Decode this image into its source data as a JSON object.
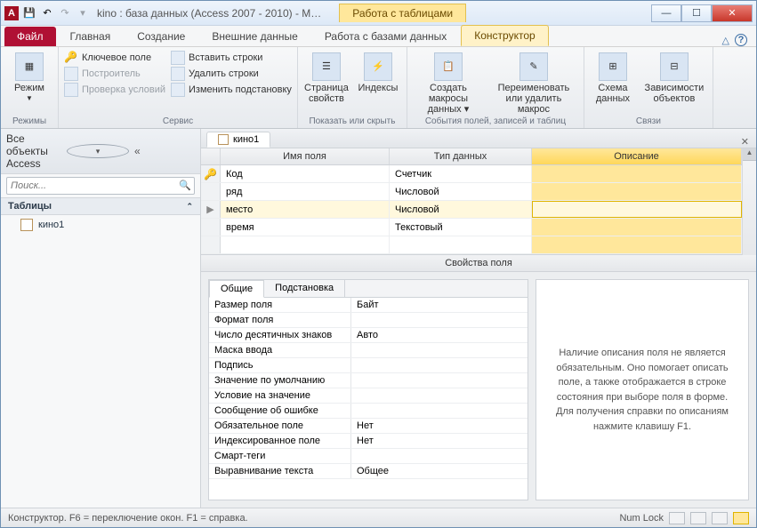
{
  "titlebar": {
    "title": "kino : база данных (Access 2007 - 2010) -  M…",
    "context_tab": "Работа с таблицами"
  },
  "tabs": {
    "file": "Файл",
    "items": [
      "Главная",
      "Создание",
      "Внешние данные",
      "Работа с базами данных"
    ],
    "context": "Конструктор"
  },
  "ribbon": {
    "group_modes": {
      "mode_btn": "Режим",
      "label": "Режимы"
    },
    "group_service": {
      "key_field": "Ключевое поле",
      "builder": "Построитель",
      "check_cond": "Проверка условий",
      "insert_rows": "Вставить строки",
      "delete_rows": "Удалить строки",
      "change_lookup": "Изменить подстановку",
      "label": "Сервис"
    },
    "group_show": {
      "prop_page": "Страница свойств",
      "indexes": "Индексы",
      "label": "Показать или скрыть"
    },
    "group_events": {
      "create_macros": "Создать макросы данных ▾",
      "rename_delete": "Переименовать или удалить макрос",
      "label": "События полей, записей и таблиц"
    },
    "group_rel": {
      "schema": "Схема данных",
      "deps": "Зависимости объектов",
      "label": "Связи"
    }
  },
  "nav": {
    "header": "Все объекты Access",
    "search_placeholder": "Поиск...",
    "section": "Таблицы",
    "items": [
      "кино1"
    ]
  },
  "doc": {
    "tab": "кино1",
    "headers": {
      "name": "Имя поля",
      "type": "Тип данных",
      "desc": "Описание"
    },
    "rows": [
      {
        "key": true,
        "name": "Код",
        "type": "Счетчик",
        "desc": ""
      },
      {
        "key": false,
        "name": "ряд",
        "type": "Числовой",
        "desc": ""
      },
      {
        "key": false,
        "name": "место",
        "type": "Числовой",
        "desc": "",
        "selected": true
      },
      {
        "key": false,
        "name": "время",
        "type": "Текстовый",
        "desc": ""
      },
      {
        "key": false,
        "name": "",
        "type": "",
        "desc": ""
      }
    ],
    "prop_caption": "Свойства поля",
    "prop_tabs": {
      "general": "Общие",
      "lookup": "Подстановка"
    },
    "props": [
      {
        "l": "Размер поля",
        "v": "Байт"
      },
      {
        "l": "Формат поля",
        "v": ""
      },
      {
        "l": "Число десятичных знаков",
        "v": "Авто"
      },
      {
        "l": "Маска ввода",
        "v": ""
      },
      {
        "l": "Подпись",
        "v": ""
      },
      {
        "l": "Значение по умолчанию",
        "v": ""
      },
      {
        "l": "Условие на значение",
        "v": ""
      },
      {
        "l": "Сообщение об ошибке",
        "v": ""
      },
      {
        "l": "Обязательное поле",
        "v": "Нет"
      },
      {
        "l": "Индексированное поле",
        "v": "Нет"
      },
      {
        "l": "Смарт-теги",
        "v": ""
      },
      {
        "l": "Выравнивание текста",
        "v": "Общее"
      }
    ],
    "help_text": "Наличие описания поля не является обязательным. Оно помогает описать поле, а также отображается в строке состояния при выборе поля в форме. Для получения справки по описаниям нажмите клавишу F1."
  },
  "status": {
    "left": "Конструктор.  F6 = переключение окон.  F1 = справка.",
    "numlock": "Num Lock"
  }
}
